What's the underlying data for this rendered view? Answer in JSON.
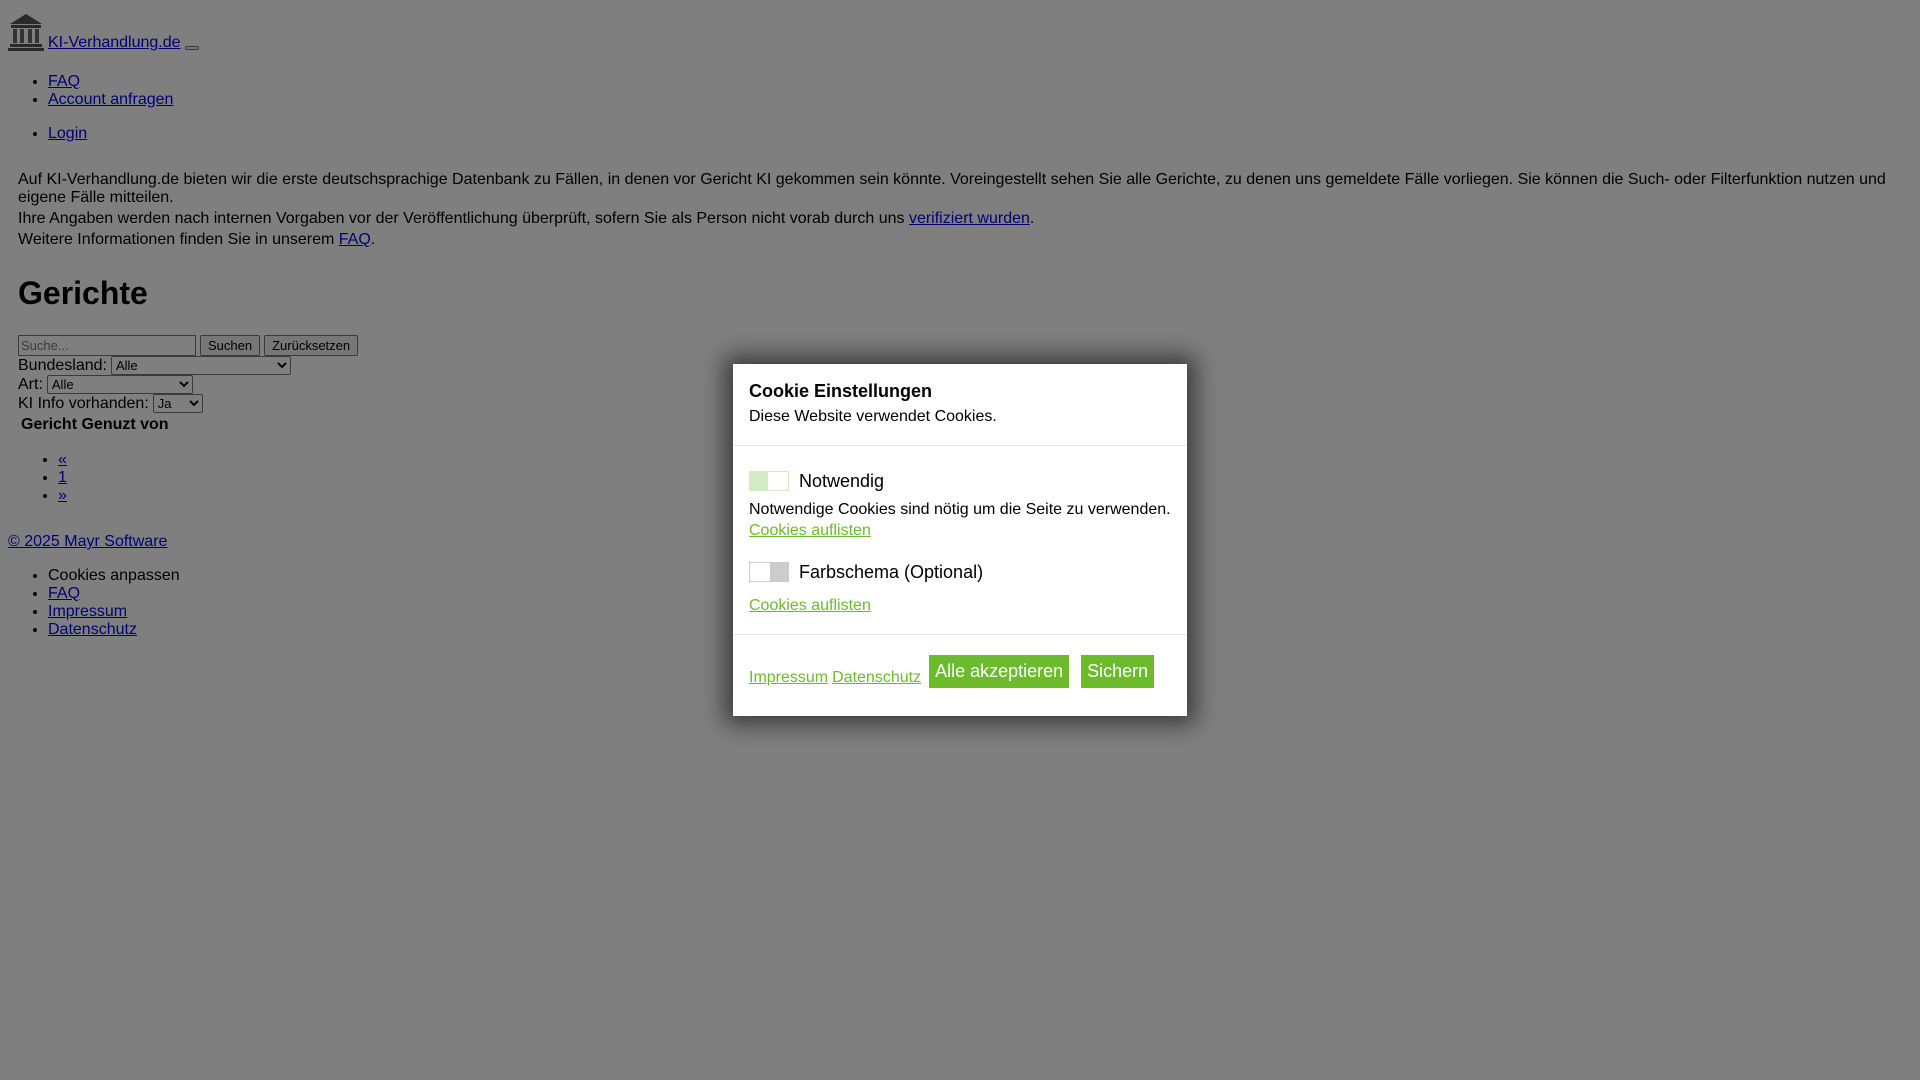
{
  "header": {
    "brand_text": "KI-Verhandlung.de"
  },
  "nav": {
    "items": [
      "FAQ",
      "Account anfragen"
    ],
    "login": "Login"
  },
  "intro": {
    "p1": "Auf KI-Verhandlung.de bieten wir die erste deutschsprachige Datenbank zu Fällen, in denen vor Gericht KI gekommen sein könnte. Voreingestellt sehen Sie alle Gerichte, zu denen uns gemeldete Fälle vorliegen. Sie können die Such- oder Filterfunktion nutzen und eigene Fälle mitteilen.",
    "p2_before": "Ihre Angaben werden nach internen Vorgaben vor der Veröffentlichung überprüft, sofern Sie als Person nicht vorab durch uns ",
    "p2_link": "verifiziert wurden",
    "p2_after": ".",
    "p3_before": "Weitere Informationen finden Sie in unserem ",
    "p3_link": "FAQ",
    "p3_after": "."
  },
  "main": {
    "title": "Gerichte",
    "search_placeholder": "Suche...",
    "search_button": "Suchen",
    "reset_button": "Zurücksetzen",
    "filters": {
      "bundesland_label": "Bundesland:",
      "bundesland_value": "Alle",
      "art_label": "Art:",
      "art_value": "Alle",
      "ki_label": "KI Info vorhanden:",
      "ki_value": "Ja"
    },
    "table_headers": [
      "Gericht",
      "Genuzt von"
    ],
    "pager": [
      "«",
      "1",
      "»"
    ]
  },
  "footer": {
    "copyright": "© 2025 Mayr Software",
    "cookies": "Cookies anpassen",
    "links": [
      "FAQ",
      "Impressum",
      "Datenschutz"
    ]
  },
  "cookie_modal": {
    "title": "Cookie Einstellungen",
    "subtitle": "Diese Website verwendet Cookies.",
    "categories": [
      {
        "label": "Notwendig",
        "desc": "Notwendige Cookies sind nötig um die Seite zu verwenden.",
        "link": "Cookies auflisten"
      },
      {
        "label": "Farbschema (Optional)",
        "desc": "",
        "link": "Cookies auflisten"
      }
    ],
    "footer_links": [
      "Impressum",
      "Datenschutz"
    ],
    "accept_all": "Alle akzeptieren",
    "save": "Sichern",
    "accent_color": "#6cbb2c"
  }
}
